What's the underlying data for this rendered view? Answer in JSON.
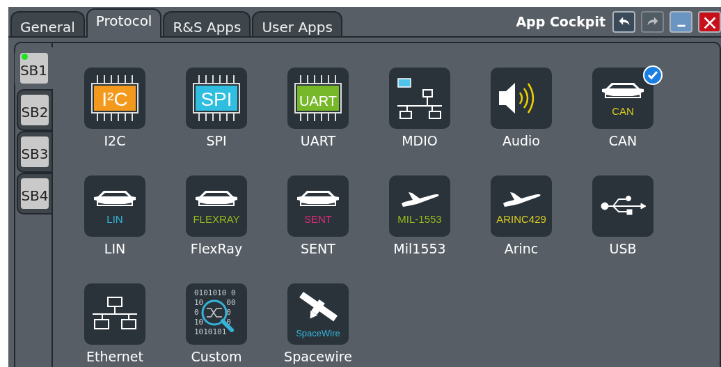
{
  "window": {
    "title": "App Cockpit",
    "buttons": [
      {
        "kind": "back",
        "disabled": false
      },
      {
        "kind": "forward",
        "disabled": true
      },
      {
        "kind": "minimize",
        "disabled": false
      },
      {
        "kind": "close",
        "disabled": false
      }
    ]
  },
  "tabs": [
    {
      "label": "General",
      "selected": false
    },
    {
      "label": "Protocol",
      "selected": true
    },
    {
      "label": "R&S Apps",
      "selected": false
    },
    {
      "label": "User Apps",
      "selected": false
    }
  ],
  "side_tabs": [
    {
      "label": "SB1",
      "selected": true,
      "active": true
    },
    {
      "label": "SB2",
      "selected": false,
      "active": false
    },
    {
      "label": "SB3",
      "selected": false,
      "active": false
    },
    {
      "label": "SB4",
      "selected": false,
      "active": false
    }
  ],
  "apps": [
    {
      "label": "I2C",
      "kind": "chip",
      "badge": "I²C",
      "color": "#f39a1e",
      "checked": false
    },
    {
      "label": "SPI",
      "kind": "chip",
      "badge": "SPI",
      "color": "#2fbde0",
      "checked": false
    },
    {
      "label": "UART",
      "kind": "chip",
      "badge": "UART",
      "color": "#76b82a",
      "checked": false
    },
    {
      "label": "MDIO",
      "kind": "mdio",
      "checked": false
    },
    {
      "label": "Audio",
      "kind": "audio",
      "checked": false
    },
    {
      "label": "CAN",
      "kind": "car",
      "badge": "CAN",
      "color": "#d8c820",
      "checked": true
    },
    {
      "label": "LIN",
      "kind": "car",
      "badge": "LIN",
      "color": "#36b3d8",
      "checked": false
    },
    {
      "label": "FlexRay",
      "kind": "car",
      "badge": "FLEXRAY",
      "color": "#94b81c",
      "checked": false
    },
    {
      "label": "SENT",
      "kind": "car",
      "badge": "SENT",
      "color": "#e0287a",
      "checked": false
    },
    {
      "label": "Mil1553",
      "kind": "plane",
      "badge": "MIL-1553",
      "color": "#94b81c",
      "checked": false
    },
    {
      "label": "Arinc",
      "kind": "plane",
      "badge": "ARINC429",
      "color": "#d8c820",
      "checked": false
    },
    {
      "label": "USB",
      "kind": "usb",
      "checked": false
    },
    {
      "label": "Ethernet",
      "kind": "ethernet",
      "checked": false
    },
    {
      "label": "Custom",
      "kind": "custom",
      "digits": [
        "0101010 0",
        "10     00",
        "0      0",
        "10     0",
        "1010101"
      ],
      "checked": false
    },
    {
      "label": "Spacewire",
      "kind": "satellite",
      "badge": "SpaceWire",
      "color": "#36b3d8",
      "checked": false
    }
  ]
}
